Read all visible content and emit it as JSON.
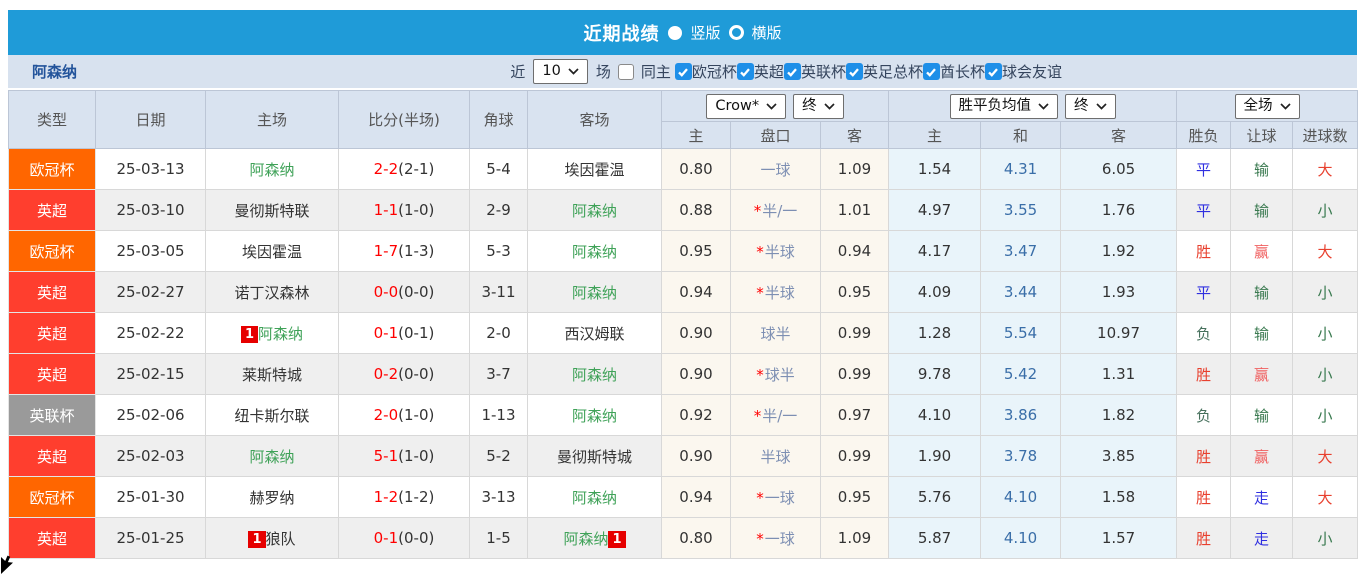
{
  "titlebar": {
    "title": "近期战绩",
    "radio_vertical": "竖版",
    "radio_horizontal": "横版"
  },
  "filterbar": {
    "team": "阿森纳",
    "recent_label": "近",
    "recent_value": "10",
    "games_label": "场",
    "same_home_label": "同主",
    "leagues": [
      "欧冠杯",
      "英超",
      "英联杯",
      "英足总杯",
      "酋长杯",
      "球会友谊"
    ]
  },
  "table": {
    "headers": {
      "col_type": "类型",
      "col_date": "日期",
      "col_home": "主场",
      "col_score": "比分(半场)",
      "col_corner": "角球",
      "col_away": "客场",
      "odds_select": "Crow*",
      "odds_time_select": "终",
      "mean_select": "胜平负均值",
      "mean_time_select": "终",
      "scope_select": "全场",
      "sub_home": "主",
      "sub_handicap": "盘口",
      "sub_away": "客",
      "sub_mean_home": "主",
      "sub_mean_draw": "和",
      "sub_mean_away": "客",
      "sub_result": "胜负",
      "sub_handicap_result": "让球",
      "sub_goals": "进球数"
    },
    "rows": [
      {
        "lg": "欧冠杯",
        "date": "25-03-13",
        "home": "阿森纳",
        "hg": true,
        "hb": null,
        "ft": "2-2",
        "ht": "(2-1)",
        "cn": "5-4",
        "away": "埃因霍温",
        "ag": false,
        "ab": null,
        "oh": "0.80",
        "st": false,
        "hcap": "一球",
        "oa": "1.09",
        "mh": "1.54",
        "md": "4.31",
        "ma": "6.05",
        "res": "平",
        "resc": "blue",
        "rh": "输",
        "rhc": "green",
        "gl": "大",
        "glc": "red"
      },
      {
        "lg": "英超",
        "date": "25-03-10",
        "home": "曼彻斯特联",
        "hg": false,
        "hb": null,
        "ft": "1-1",
        "ht": "(1-0)",
        "cn": "2-9",
        "away": "阿森纳",
        "ag": true,
        "ab": null,
        "oh": "0.88",
        "st": true,
        "hcap": "半/一",
        "oa": "1.01",
        "mh": "4.97",
        "md": "3.55",
        "ma": "1.76",
        "res": "平",
        "resc": "blue",
        "rh": "输",
        "rhc": "green",
        "gl": "小",
        "glc": "green"
      },
      {
        "lg": "欧冠杯",
        "date": "25-03-05",
        "home": "埃因霍温",
        "hg": false,
        "hb": null,
        "ft": "1-7",
        "ht": "(1-3)",
        "cn": "5-3",
        "away": "阿森纳",
        "ag": true,
        "ab": null,
        "oh": "0.95",
        "st": true,
        "hcap": "半球",
        "oa": "0.94",
        "mh": "4.17",
        "md": "3.47",
        "ma": "1.92",
        "res": "胜",
        "resc": "red",
        "rh": "赢",
        "rhc": "pink",
        "gl": "大",
        "glc": "red"
      },
      {
        "lg": "英超",
        "date": "25-02-27",
        "home": "诺丁汉森林",
        "hg": false,
        "hb": null,
        "ft": "0-0",
        "ht": "(0-0)",
        "cn": "3-11",
        "away": "阿森纳",
        "ag": true,
        "ab": null,
        "oh": "0.94",
        "st": true,
        "hcap": "半球",
        "oa": "0.95",
        "mh": "4.09",
        "md": "3.44",
        "ma": "1.93",
        "res": "平",
        "resc": "blue",
        "rh": "输",
        "rhc": "green",
        "gl": "小",
        "glc": "green"
      },
      {
        "lg": "英超",
        "date": "25-02-22",
        "home": "阿森纳",
        "hg": true,
        "hb": "1",
        "ft": "0-1",
        "ht": "(0-1)",
        "cn": "2-0",
        "away": "西汉姆联",
        "ag": false,
        "ab": null,
        "oh": "0.90",
        "st": false,
        "hcap": "球半",
        "oa": "0.99",
        "mh": "1.28",
        "md": "5.54",
        "ma": "10.97",
        "res": "负",
        "resc": "darkgreen",
        "rh": "输",
        "rhc": "green",
        "gl": "小",
        "glc": "green"
      },
      {
        "lg": "英超",
        "date": "25-02-15",
        "home": "莱斯特城",
        "hg": false,
        "hb": null,
        "ft": "0-2",
        "ht": "(0-0)",
        "cn": "3-7",
        "away": "阿森纳",
        "ag": true,
        "ab": null,
        "oh": "0.90",
        "st": true,
        "hcap": "球半",
        "oa": "0.99",
        "mh": "9.78",
        "md": "5.42",
        "ma": "1.31",
        "res": "胜",
        "resc": "red",
        "rh": "赢",
        "rhc": "pink",
        "gl": "小",
        "glc": "green"
      },
      {
        "lg": "英联杯",
        "date": "25-02-06",
        "home": "纽卡斯尔联",
        "hg": false,
        "hb": null,
        "ft": "2-0",
        "ht": "(1-0)",
        "cn": "1-13",
        "away": "阿森纳",
        "ag": true,
        "ab": null,
        "oh": "0.92",
        "st": true,
        "hcap": "半/一",
        "oa": "0.97",
        "mh": "4.10",
        "md": "3.86",
        "ma": "1.82",
        "res": "负",
        "resc": "darkgreen",
        "rh": "输",
        "rhc": "green",
        "gl": "小",
        "glc": "green"
      },
      {
        "lg": "英超",
        "date": "25-02-03",
        "home": "阿森纳",
        "hg": true,
        "hb": null,
        "ft": "5-1",
        "ht": "(1-0)",
        "cn": "5-2",
        "away": "曼彻斯特城",
        "ag": false,
        "ab": null,
        "oh": "0.90",
        "st": false,
        "hcap": "半球",
        "oa": "0.99",
        "mh": "1.90",
        "md": "3.78",
        "ma": "3.85",
        "res": "胜",
        "resc": "red",
        "rh": "赢",
        "rhc": "pink",
        "gl": "大",
        "glc": "red"
      },
      {
        "lg": "欧冠杯",
        "date": "25-01-30",
        "home": "赫罗纳",
        "hg": false,
        "hb": null,
        "ft": "1-2",
        "ht": "(1-2)",
        "cn": "3-13",
        "away": "阿森纳",
        "ag": true,
        "ab": null,
        "oh": "0.94",
        "st": true,
        "hcap": "一球",
        "oa": "0.95",
        "mh": "5.76",
        "md": "4.10",
        "ma": "1.58",
        "res": "胜",
        "resc": "red",
        "rh": "走",
        "rhc": "blue",
        "gl": "大",
        "glc": "red"
      },
      {
        "lg": "英超",
        "date": "25-01-25",
        "home": "狼队",
        "hg": false,
        "hb": "1",
        "ft": "0-1",
        "ht": "(0-0)",
        "cn": "1-5",
        "away": "阿森纳",
        "ag": true,
        "ab": "1",
        "oh": "0.80",
        "st": true,
        "hcap": "一球",
        "oa": "1.09",
        "mh": "5.87",
        "md": "4.10",
        "ma": "1.57",
        "res": "胜",
        "resc": "red",
        "rh": "走",
        "rhc": "blue",
        "gl": "小",
        "glc": "green"
      }
    ]
  },
  "colors": {
    "accent_blue": "#1F9BD8",
    "filter_bg": "#D8E2EF",
    "header_bg": "#D9E3F0",
    "league": {
      "欧冠杯": "#FF6600",
      "英超": "#FF3E2E",
      "英联杯": "#9A9A9A"
    },
    "status": {
      "red": "#E8402E",
      "pink": "#F06060",
      "blue": "#2F2FE0",
      "green": "#3A7A50",
      "darkgreen": "#46705C"
    },
    "arsenal_green": "#3FA258",
    "score_red": "#FF0000",
    "handicap_slate": "#7D8FB3",
    "mean_blue": "#3A6EA8",
    "badge_red": "#E60000",
    "checkbox_blue": "#1E8FE8"
  }
}
